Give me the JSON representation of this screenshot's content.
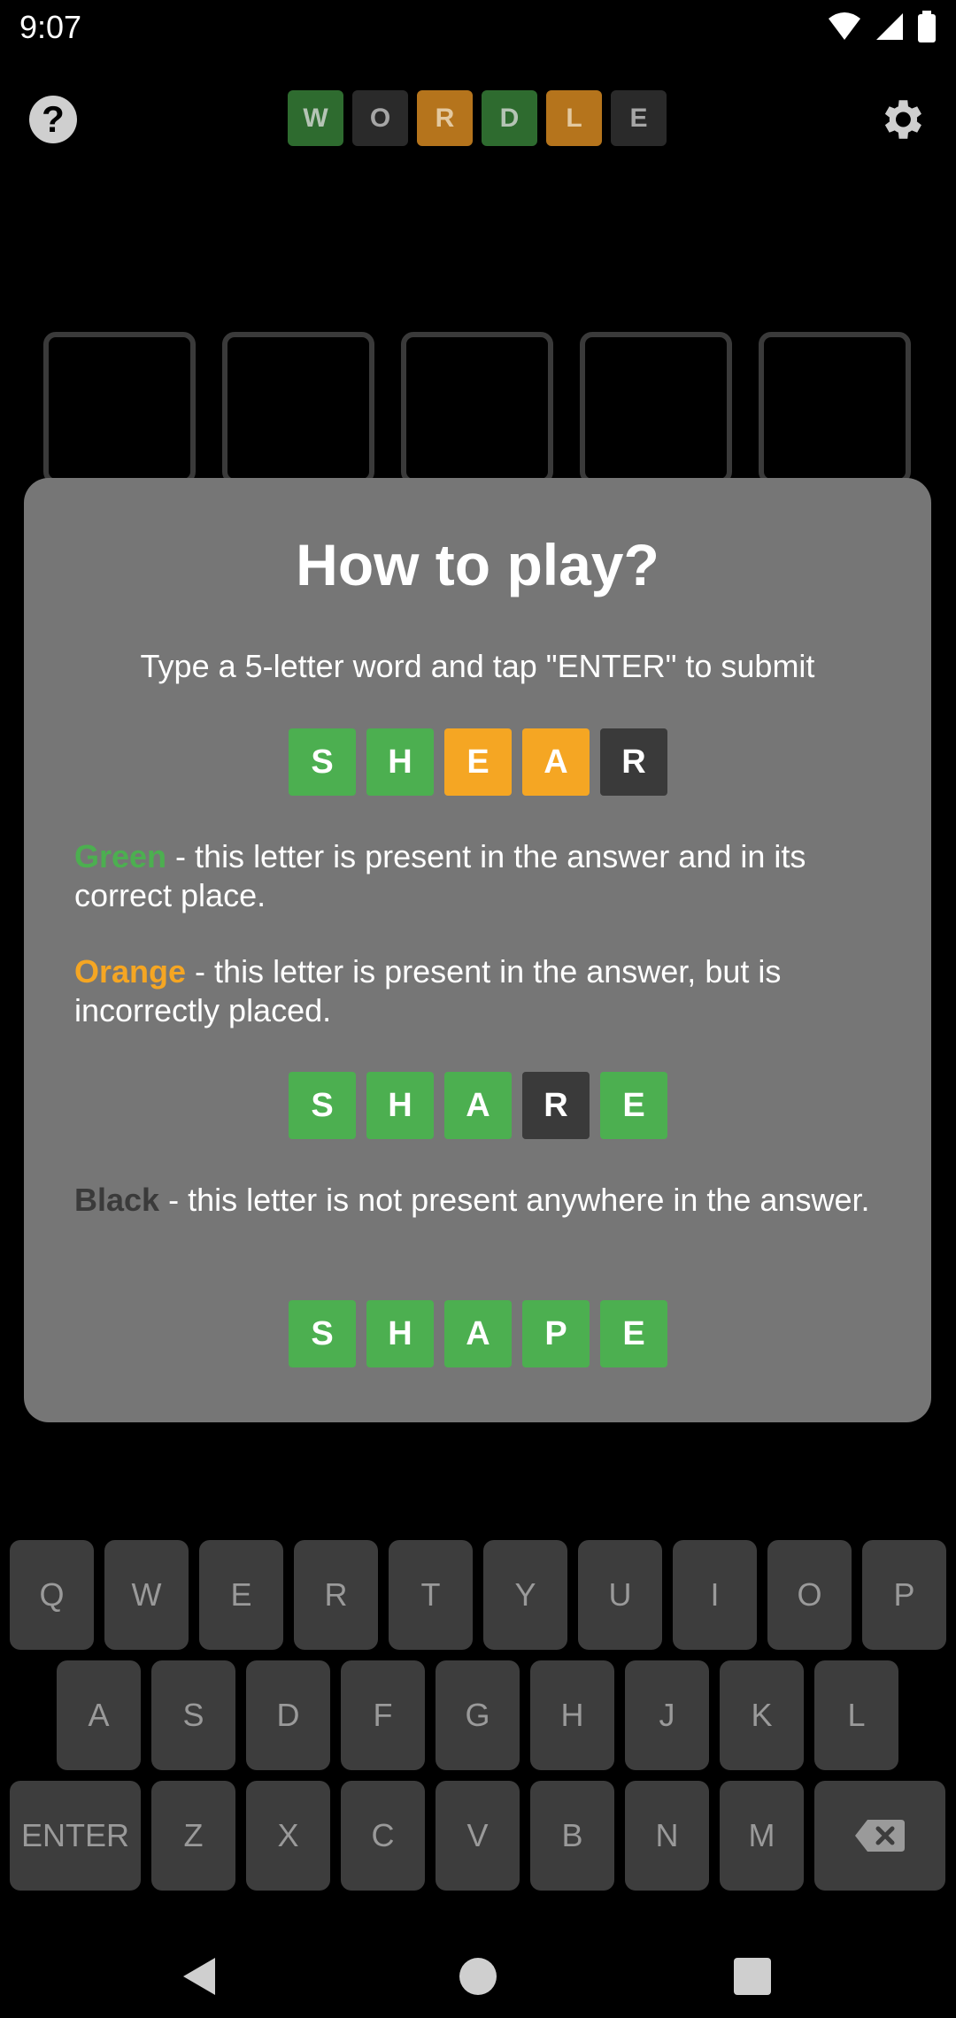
{
  "status_bar": {
    "time": "9:07"
  },
  "header": {
    "help_label": "?",
    "logo_letters": [
      "W",
      "O",
      "R",
      "D",
      "L",
      "E"
    ],
    "logo_colors": [
      "green",
      "dark",
      "orange",
      "green",
      "orange",
      "dark"
    ]
  },
  "modal": {
    "title": "How to play?",
    "subtitle": "Type a 5-letter word and tap \"ENTER\" to submit",
    "example1": {
      "letters": [
        "S",
        "H",
        "E",
        "A",
        "R"
      ],
      "colors": [
        "green",
        "green",
        "orange",
        "orange",
        "dark"
      ]
    },
    "green_keyword": "Green",
    "green_text": " - this letter is present in the answer and in its correct place.",
    "orange_keyword": "Orange",
    "orange_text": " - this letter is present in the answer, but is incorrectly placed.",
    "example2": {
      "letters": [
        "S",
        "H",
        "A",
        "R",
        "E"
      ],
      "colors": [
        "green",
        "green",
        "green",
        "dark",
        "green"
      ]
    },
    "black_keyword": "Black",
    "black_text": " - this letter is not present anywhere in the answer.",
    "example3": {
      "letters": [
        "S",
        "H",
        "A",
        "P",
        "E"
      ],
      "colors": [
        "green",
        "green",
        "green",
        "green",
        "green"
      ]
    }
  },
  "keyboard": {
    "row1": [
      "Q",
      "W",
      "E",
      "R",
      "T",
      "Y",
      "U",
      "I",
      "O",
      "P"
    ],
    "row2": [
      "A",
      "S",
      "D",
      "F",
      "G",
      "H",
      "J",
      "K",
      "L"
    ],
    "row3": [
      "Z",
      "X",
      "C",
      "V",
      "B",
      "N",
      "M"
    ],
    "enter_label": "ENTER",
    "backspace_icon": "backspace-icon"
  },
  "colors": {
    "green": "#4caf50",
    "orange": "#f5a623",
    "dark": "#3a3a3a",
    "modal_bg": "#767676"
  }
}
